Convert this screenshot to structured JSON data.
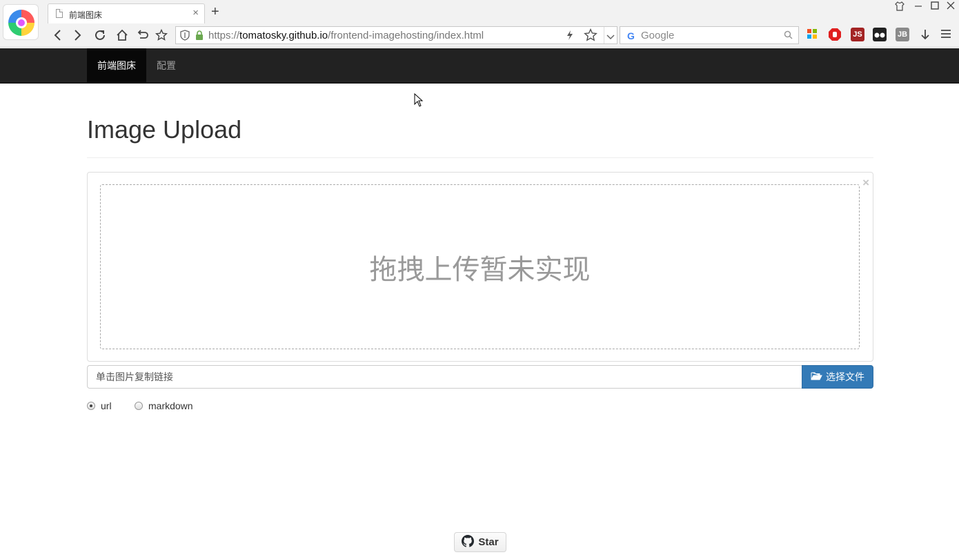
{
  "browser": {
    "tab_title": "前端图床",
    "tab_close": "×",
    "new_tab": "+",
    "url_host": "https://",
    "url_domain": "tomatosky.github.io",
    "url_path": "/frontend-imagehosting/index.html",
    "search_placeholder": "Google",
    "window_controls": [
      "shirt-icon",
      "minimize-icon",
      "maximize-icon",
      "close-icon"
    ],
    "toolbar_icons": [
      "back-icon",
      "forward-icon",
      "reload-icon",
      "home-icon",
      "undo-icon",
      "bookmark-icon"
    ],
    "extension_icons": [
      "grid-extension-icon",
      "adblock-extension-icon",
      "js-extension-icon",
      "glasses-extension-icon",
      "jb-extension-icon",
      "download-icon",
      "menu-icon"
    ],
    "extension_labels": {
      "js": "JS",
      "jb": "JB"
    }
  },
  "navbar": {
    "items": [
      {
        "label": "前端图床",
        "active": true
      },
      {
        "label": "配置",
        "active": false
      }
    ]
  },
  "main": {
    "title": "Image Upload",
    "panel_close": "×",
    "dropzone_text": "拖拽上传暂未实现",
    "link_placeholder": "单击图片复制链接",
    "choose_file_label": "选择文件",
    "format_options": [
      {
        "label": "url",
        "checked": true
      },
      {
        "label": "markdown",
        "checked": false
      }
    ]
  },
  "footer": {
    "star_label": "Star"
  },
  "colors": {
    "navbar_bg": "#222222",
    "primary_button": "#337ab7",
    "dropzone_text": "#999999"
  }
}
